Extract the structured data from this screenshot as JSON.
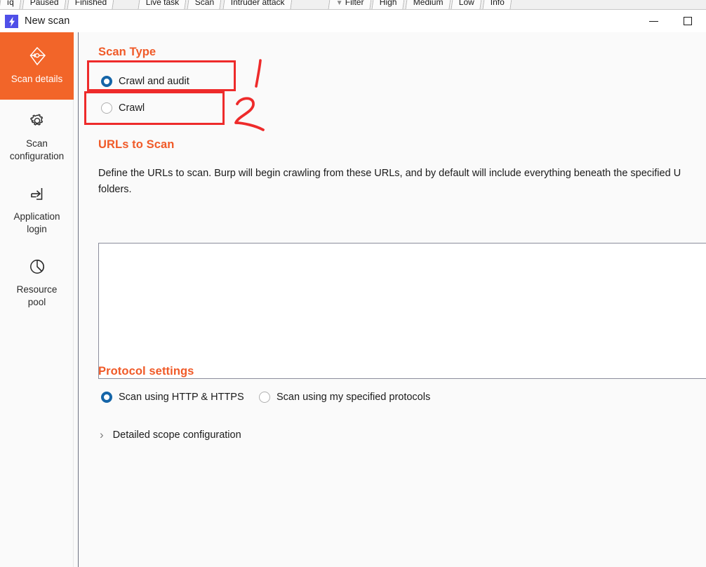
{
  "background_tabs": {
    "left_group": [
      "ıq",
      "Paused",
      "Finished"
    ],
    "mid_group": [
      "Live task",
      "Scan",
      "Intruder attack"
    ],
    "right_group": [
      "Filter",
      "High",
      "Medium",
      "Low",
      "Info"
    ],
    "filter_icon": "funnel-icon"
  },
  "window": {
    "title": "New scan",
    "logo_icon": "burp-lightning-icon",
    "minimize_icon": "minimize-icon",
    "maximize_icon": "maximize-icon"
  },
  "sidebar": {
    "items": [
      {
        "label": "Scan details",
        "icon": "kite-target-icon",
        "active": true
      },
      {
        "label": "Scan\nconfiguration",
        "icon": "gear-icon",
        "active": false
      },
      {
        "label": "Application\nlogin",
        "icon": "login-arrow-icon",
        "active": false
      },
      {
        "label": "Resource\npool",
        "icon": "pie-chart-icon",
        "active": false
      }
    ],
    "active_color": "#f26529"
  },
  "main": {
    "scan_type": {
      "heading": "Scan Type",
      "options": [
        {
          "label": "Crawl and audit",
          "selected": true
        },
        {
          "label": "Crawl",
          "selected": false
        }
      ]
    },
    "urls_to_scan": {
      "heading": "URLs to Scan",
      "description": "Define the URLs to scan. Burp will begin crawling from these URLs, and by default will include everything beneath the specified U",
      "description_line2": "folders.",
      "textarea_value": "",
      "textarea_placeholder": ""
    },
    "protocol_settings": {
      "heading": "Protocol settings",
      "options": [
        {
          "label": "Scan using HTTP & HTTPS",
          "selected": true
        },
        {
          "label": "Scan using my specified protocols",
          "selected": false
        }
      ],
      "detailed_scope": {
        "label": "Detailed scope configuration",
        "icon": "chevron-right-icon",
        "expanded": false
      }
    }
  },
  "annotations": {
    "color": "#ee2b2b",
    "marks": [
      {
        "name": "annotation-box-1",
        "target": "Crawl and audit"
      },
      {
        "name": "annotation-box-2",
        "target": "Crawl"
      },
      {
        "name": "annotation-number-1",
        "text": "1"
      },
      {
        "name": "annotation-number-2",
        "text": "2"
      }
    ]
  }
}
